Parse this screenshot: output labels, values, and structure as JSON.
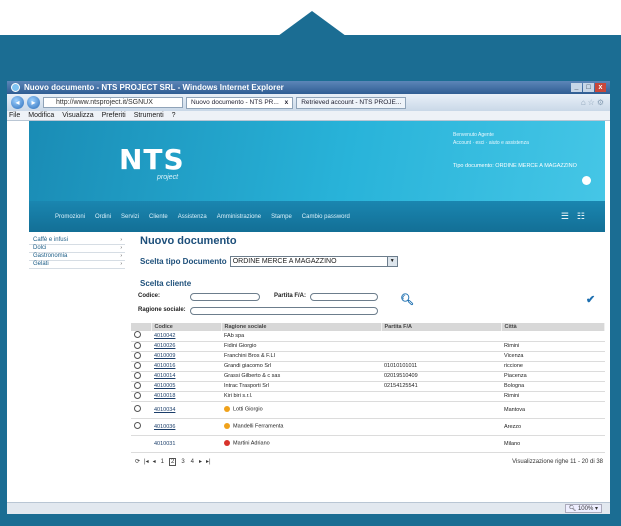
{
  "window": {
    "title": "Nuovo documento - NTS PROJECT SRL - Windows Internet Explorer",
    "controls": [
      "_",
      "□",
      "x"
    ]
  },
  "browser": {
    "back_icon": "back-arrow-icon",
    "forward_icon": "forward-arrow-icon",
    "address": "http://www.ntsproject.it/SGNUX",
    "tabs": [
      {
        "label": "Nuovo documento - NTS PR...",
        "close": "x",
        "active": true
      },
      {
        "label": "Retrieved account - NTS PROJE...",
        "active": false
      }
    ],
    "menu": [
      "File",
      "Modifica",
      "Visualizza",
      "Preferiti",
      "Strumenti",
      "?"
    ]
  },
  "site": {
    "logo": "NTS",
    "logo_sub": "project",
    "topright_lines": [
      "Benvenuto  Agente",
      "Account  ·  esci  ·  aiuto e assistenza"
    ],
    "tipo_label": "Tipo documento:  ORDINE MERCE A MAGAZZINO",
    "nav": [
      "Promozioni",
      "Ordini",
      "Servizi",
      "Cliente",
      "Assistenza",
      "Amministrazione",
      "Stampe",
      "Cambio password"
    ]
  },
  "sidebar": {
    "items": [
      {
        "label": "Caffè e infusi",
        "arrow": "›"
      },
      {
        "label": "Dolci",
        "arrow": "›"
      },
      {
        "label": "Gastronomia",
        "arrow": "›"
      },
      {
        "label": "Gelati",
        "arrow": "›"
      }
    ]
  },
  "main": {
    "title": "Nuovo documento",
    "tipo_label": "Scelta tipo Documento",
    "tipo_value": "ORDINE MERCE A MAGAZZINO",
    "dropdown_arrow": "▼",
    "cliente_label": "Scelta cliente",
    "codice_label": "Codice:",
    "partita_label": "Partita F/A:",
    "ragione_label": "Ragione sociale:",
    "search_icon": "search-icon",
    "confirm_icon": "checkmark-icon"
  },
  "grid": {
    "columns": [
      "Codice",
      "Ragione sociale",
      "Partita F/A",
      "Città"
    ],
    "rows": [
      {
        "radio": true,
        "code": "4010042",
        "name": "FAb spa",
        "piva": "",
        "city": "",
        "status": ""
      },
      {
        "radio": true,
        "code": "4010026",
        "name": "Fidini Giorgio",
        "piva": "",
        "city": "Rimini",
        "status": ""
      },
      {
        "radio": true,
        "code": "4010009",
        "name": "Franchini Bros & F.LI",
        "piva": "",
        "city": "Vicenza",
        "status": ""
      },
      {
        "radio": true,
        "code": "4010016",
        "name": "Grandi giacomo Srl",
        "piva": "01010101011",
        "city": "riccione",
        "status": ""
      },
      {
        "radio": true,
        "code": "4010014",
        "name": "Grassi Gilberto & c sas",
        "piva": "02019510409",
        "city": "Piacenza",
        "status": ""
      },
      {
        "radio": true,
        "code": "4010005",
        "name": "Intrac Trasporti Srl",
        "piva": "02154125541",
        "city": "Bologna",
        "status": ""
      },
      {
        "radio": true,
        "code": "4010018",
        "name": "Kiri biri s.r.l.",
        "piva": "",
        "city": "Rimini",
        "status": ""
      },
      {
        "radio": true,
        "code": "4010034",
        "name": "Lotti Giorgio",
        "piva": "",
        "city": "Mantova",
        "status": "orange"
      },
      {
        "radio": true,
        "code": "4010036",
        "name": "Mandelli Ferramenta",
        "piva": "",
        "city": "Arezzo",
        "status": "orange"
      },
      {
        "radio": false,
        "code": "4010031",
        "name": "Martini Adriano",
        "piva": "",
        "city": "Milano",
        "status": "red"
      }
    ]
  },
  "pager": {
    "first": "|◂",
    "prev": "◂",
    "pages": [
      "1",
      "2",
      "3",
      "4"
    ],
    "current": "2",
    "next": "▸",
    "last": "▸|",
    "info": "Visualizzazione righe 11 - 20 di 38"
  },
  "status": {
    "zoom": "100%"
  },
  "colors": {
    "frame": "#1b6d93",
    "banner": "#28b3d9",
    "accent": "#1d4f7a"
  }
}
